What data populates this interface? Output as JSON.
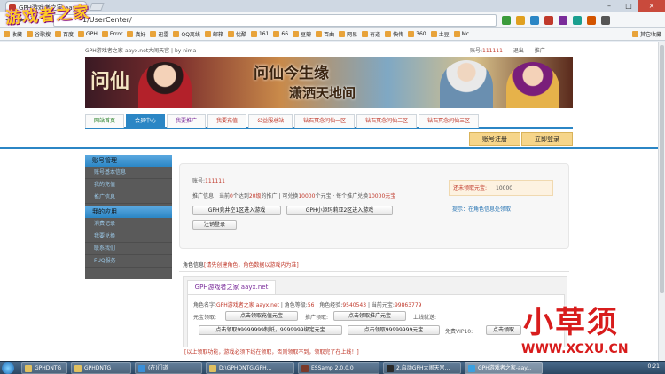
{
  "browser": {
    "tab_title": "GPH游戏者之家 aayx.net",
    "url": "1/UserCenter/"
  },
  "bookmarks": [
    "收藏",
    "谷歌搜",
    "百度",
    "GPH",
    "Error",
    "真好",
    "迅雷",
    "QQ离线",
    "邮箱",
    "优酷",
    "161",
    "66",
    "豆瓣",
    "百曲",
    "网易",
    "有道",
    "快传",
    "360",
    "土豆",
    "Mc"
  ],
  "bookmarks_other": "其它收藏",
  "overlay_logo": "游戏者之家",
  "page": {
    "top_info": "GPH游戏者之家-aayx.net大闹天宫 | by nima",
    "account_label": "账号:",
    "account_value": "111111",
    "logout": "退出",
    "promote": "推广",
    "banner_logo": "问仙",
    "banner_title": "问仙今生缘",
    "banner_title2": "潇洒天地间",
    "nav": [
      "网站首页",
      "会员中心",
      "我要推广",
      "我要充值",
      "公益服总站",
      "钻石冥念问仙一区",
      "钻石冥念问仙二区",
      "钻石冥念问仙三区"
    ],
    "register": "账号注册",
    "login": "立即登录"
  },
  "sidebar": {
    "header1": "账号管理",
    "items1": [
      "账号基本信息",
      "我的充值",
      "推广信息"
    ],
    "header2": "我的应用",
    "items2": [
      "消费记录",
      "我要兑换",
      "联系我们",
      "FUQ服务"
    ]
  },
  "info": {
    "account_label": "账号:",
    "account_value": "111111",
    "promo_prefix": "推广信息：当前",
    "promo_count": "0",
    "promo_mid1": "个达到",
    "promo_level": "20级",
    "promo_mid2": "的推广 | 可兑换",
    "promo_amount": "10000",
    "promo_mid3": "个元宝 · 每个推广兑换",
    "promo_unit": "10000元宝",
    "btn_zone1": "GPH竞井空1区进入游戏",
    "btn_zone2": "GPH小添玛莉亚2区进入游戏",
    "btn_logout": "注销登录",
    "stat_label": "还未领取元宝:",
    "stat_value": "10000",
    "tip": "提示：在角色信息处领取"
  },
  "role": {
    "header_prefix": "角色信息",
    "header_note": "[请先创建角色，角色数据以游戏内为准]",
    "tab": "GPH游戏者之家 aayx.net",
    "name_label": "角色名字:",
    "name_value": "GPH游戏者之家 aayx.net",
    "level_label": "| 角色等级:",
    "level_value": "56",
    "exp_label": "| 角色经验:",
    "exp_value": "9540543",
    "yb_label": "| 当前元宝:",
    "yb_value": "99863779",
    "yb_get": "元宝领取:",
    "btn_recharge": "点击领取充值元宝",
    "promo_get": "推广领取:",
    "btn_promo": "点击领取推广元宝",
    "online_get": "上线就送:",
    "btn_dongle": "点击领取99999999制纸，9999999绑定元宝",
    "btn_yb": "点击领取99999999元宝",
    "vip_label": "免费VIP10:",
    "btn_vip": "点击领取"
  },
  "warning": "[以上领取功能，游戏必须下线在领取，否则领取不到，领取完了在上线！]",
  "watermark": {
    "title": "小草须",
    "url": "WWW.XCXU.CN"
  },
  "taskbar": {
    "items": [
      "GPHDNTG",
      "(在)门道",
      "D:\\GPHDNTG\\GPH...",
      "ESSamp 2.0.0.0",
      "2.启动GPH大闹天宫...",
      "GPH游戏者之家-aay..."
    ],
    "clock": "0:21"
  }
}
